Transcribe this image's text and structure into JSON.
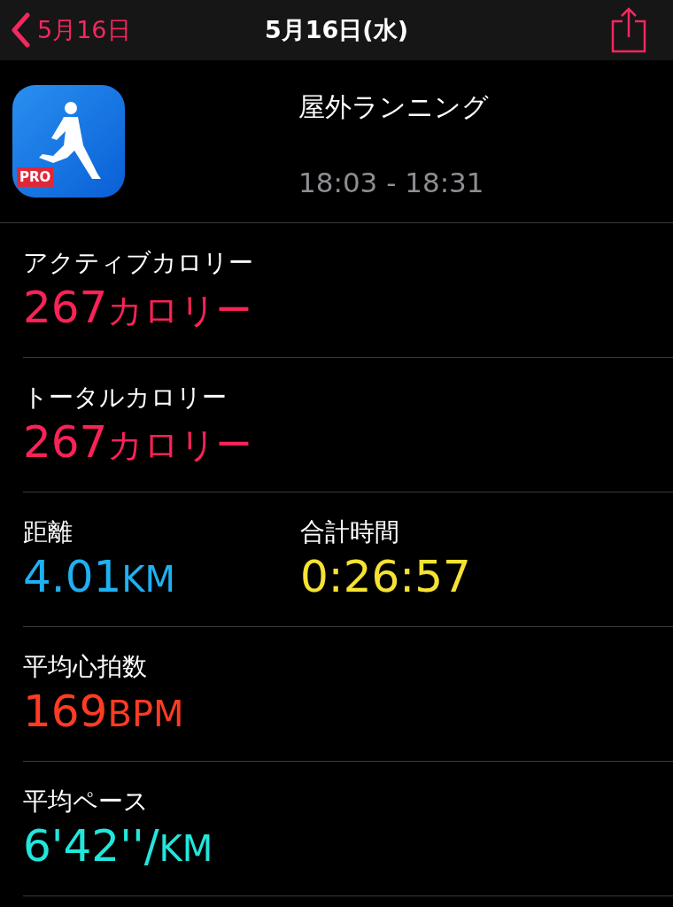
{
  "nav_bar": {
    "back_label": "5月16日",
    "title": "5月16日(水)"
  },
  "workout": {
    "app_badge": "PRO",
    "type": "屋外ランニング",
    "time_range": "18:03 - 18:31"
  },
  "metric_rows": [
    {
      "items": [
        {
          "label": "アクティブカロリー",
          "value": "267",
          "unit": "カロリー",
          "color": "#fa2257"
        }
      ]
    },
    {
      "items": [
        {
          "label": "トータルカロリー",
          "value": "267",
          "unit": "カロリー",
          "color": "#fa2257"
        }
      ]
    },
    {
      "items": [
        {
          "label": "距離",
          "value": "4.01",
          "unit": "KM",
          "color": "#1fb0f2"
        },
        {
          "label": "合計時間",
          "value": "0:26:57",
          "color": "#f6e233"
        }
      ]
    },
    {
      "items": [
        {
          "label": "平均心拍数",
          "value": "169",
          "unit": "BPM",
          "color": "#ff3b24"
        }
      ]
    },
    {
      "items": [
        {
          "label": "平均ペース",
          "value": "6'42''/",
          "unit": "KM",
          "color": "#22e6dc"
        }
      ]
    }
  ]
}
